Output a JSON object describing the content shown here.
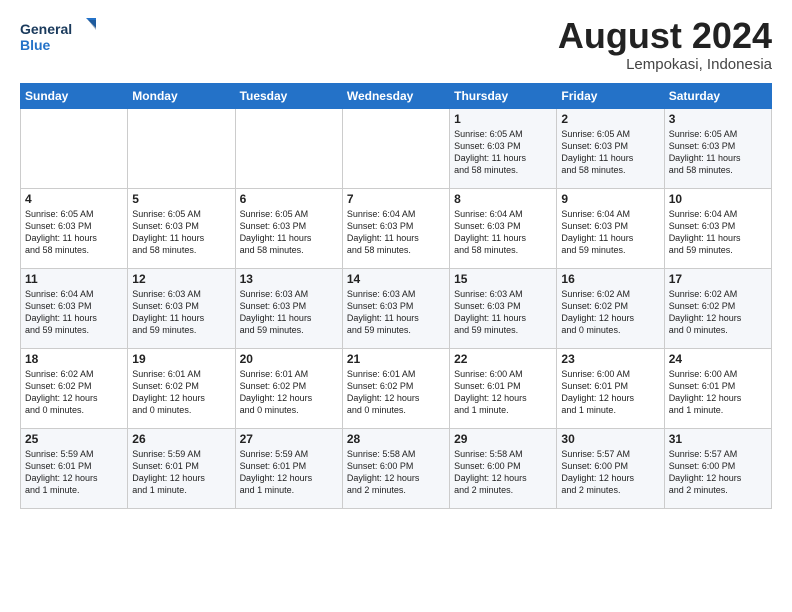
{
  "header": {
    "logo_general": "General",
    "logo_blue": "Blue",
    "month_title": "August 2024",
    "location": "Lempokasi, Indonesia"
  },
  "weekdays": [
    "Sunday",
    "Monday",
    "Tuesday",
    "Wednesday",
    "Thursday",
    "Friday",
    "Saturday"
  ],
  "weeks": [
    [
      {
        "day": "",
        "text": ""
      },
      {
        "day": "",
        "text": ""
      },
      {
        "day": "",
        "text": ""
      },
      {
        "day": "",
        "text": ""
      },
      {
        "day": "1",
        "text": "Sunrise: 6:05 AM\nSunset: 6:03 PM\nDaylight: 11 hours\nand 58 minutes."
      },
      {
        "day": "2",
        "text": "Sunrise: 6:05 AM\nSunset: 6:03 PM\nDaylight: 11 hours\nand 58 minutes."
      },
      {
        "day": "3",
        "text": "Sunrise: 6:05 AM\nSunset: 6:03 PM\nDaylight: 11 hours\nand 58 minutes."
      }
    ],
    [
      {
        "day": "4",
        "text": "Sunrise: 6:05 AM\nSunset: 6:03 PM\nDaylight: 11 hours\nand 58 minutes."
      },
      {
        "day": "5",
        "text": "Sunrise: 6:05 AM\nSunset: 6:03 PM\nDaylight: 11 hours\nand 58 minutes."
      },
      {
        "day": "6",
        "text": "Sunrise: 6:05 AM\nSunset: 6:03 PM\nDaylight: 11 hours\nand 58 minutes."
      },
      {
        "day": "7",
        "text": "Sunrise: 6:04 AM\nSunset: 6:03 PM\nDaylight: 11 hours\nand 58 minutes."
      },
      {
        "day": "8",
        "text": "Sunrise: 6:04 AM\nSunset: 6:03 PM\nDaylight: 11 hours\nand 58 minutes."
      },
      {
        "day": "9",
        "text": "Sunrise: 6:04 AM\nSunset: 6:03 PM\nDaylight: 11 hours\nand 59 minutes."
      },
      {
        "day": "10",
        "text": "Sunrise: 6:04 AM\nSunset: 6:03 PM\nDaylight: 11 hours\nand 59 minutes."
      }
    ],
    [
      {
        "day": "11",
        "text": "Sunrise: 6:04 AM\nSunset: 6:03 PM\nDaylight: 11 hours\nand 59 minutes."
      },
      {
        "day": "12",
        "text": "Sunrise: 6:03 AM\nSunset: 6:03 PM\nDaylight: 11 hours\nand 59 minutes."
      },
      {
        "day": "13",
        "text": "Sunrise: 6:03 AM\nSunset: 6:03 PM\nDaylight: 11 hours\nand 59 minutes."
      },
      {
        "day": "14",
        "text": "Sunrise: 6:03 AM\nSunset: 6:03 PM\nDaylight: 11 hours\nand 59 minutes."
      },
      {
        "day": "15",
        "text": "Sunrise: 6:03 AM\nSunset: 6:03 PM\nDaylight: 11 hours\nand 59 minutes."
      },
      {
        "day": "16",
        "text": "Sunrise: 6:02 AM\nSunset: 6:02 PM\nDaylight: 12 hours\nand 0 minutes."
      },
      {
        "day": "17",
        "text": "Sunrise: 6:02 AM\nSunset: 6:02 PM\nDaylight: 12 hours\nand 0 minutes."
      }
    ],
    [
      {
        "day": "18",
        "text": "Sunrise: 6:02 AM\nSunset: 6:02 PM\nDaylight: 12 hours\nand 0 minutes."
      },
      {
        "day": "19",
        "text": "Sunrise: 6:01 AM\nSunset: 6:02 PM\nDaylight: 12 hours\nand 0 minutes."
      },
      {
        "day": "20",
        "text": "Sunrise: 6:01 AM\nSunset: 6:02 PM\nDaylight: 12 hours\nand 0 minutes."
      },
      {
        "day": "21",
        "text": "Sunrise: 6:01 AM\nSunset: 6:02 PM\nDaylight: 12 hours\nand 0 minutes."
      },
      {
        "day": "22",
        "text": "Sunrise: 6:00 AM\nSunset: 6:01 PM\nDaylight: 12 hours\nand 1 minute."
      },
      {
        "day": "23",
        "text": "Sunrise: 6:00 AM\nSunset: 6:01 PM\nDaylight: 12 hours\nand 1 minute."
      },
      {
        "day": "24",
        "text": "Sunrise: 6:00 AM\nSunset: 6:01 PM\nDaylight: 12 hours\nand 1 minute."
      }
    ],
    [
      {
        "day": "25",
        "text": "Sunrise: 5:59 AM\nSunset: 6:01 PM\nDaylight: 12 hours\nand 1 minute."
      },
      {
        "day": "26",
        "text": "Sunrise: 5:59 AM\nSunset: 6:01 PM\nDaylight: 12 hours\nand 1 minute."
      },
      {
        "day": "27",
        "text": "Sunrise: 5:59 AM\nSunset: 6:01 PM\nDaylight: 12 hours\nand 1 minute."
      },
      {
        "day": "28",
        "text": "Sunrise: 5:58 AM\nSunset: 6:00 PM\nDaylight: 12 hours\nand 2 minutes."
      },
      {
        "day": "29",
        "text": "Sunrise: 5:58 AM\nSunset: 6:00 PM\nDaylight: 12 hours\nand 2 minutes."
      },
      {
        "day": "30",
        "text": "Sunrise: 5:57 AM\nSunset: 6:00 PM\nDaylight: 12 hours\nand 2 minutes."
      },
      {
        "day": "31",
        "text": "Sunrise: 5:57 AM\nSunset: 6:00 PM\nDaylight: 12 hours\nand 2 minutes."
      }
    ]
  ]
}
